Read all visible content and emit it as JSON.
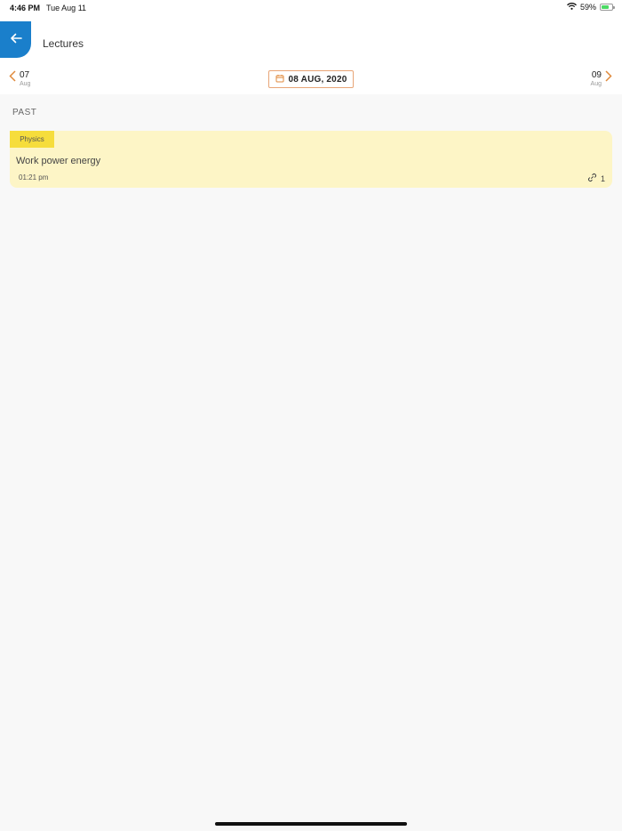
{
  "status_bar": {
    "time": "4:46 PM",
    "date": "Tue Aug 11",
    "battery_percent": "59%",
    "battery_level": 0.59
  },
  "header": {
    "title": "Lectures",
    "back_icon": "arrow-left-icon",
    "accent_color": "#1a7fcb"
  },
  "date_nav": {
    "prev": {
      "day": "07",
      "month": "Aug"
    },
    "current": "08 AUG, 2020",
    "next": {
      "day": "09",
      "month": "Aug"
    },
    "accent_color": "#e08a3c"
  },
  "section": {
    "label": "PAST"
  },
  "lectures": [
    {
      "subject": "Physics",
      "title": "Work power energy",
      "time": "01:21 pm",
      "attachments": "1",
      "card_color": "#fdf5c6",
      "tag_color": "#f6dd3c"
    }
  ]
}
